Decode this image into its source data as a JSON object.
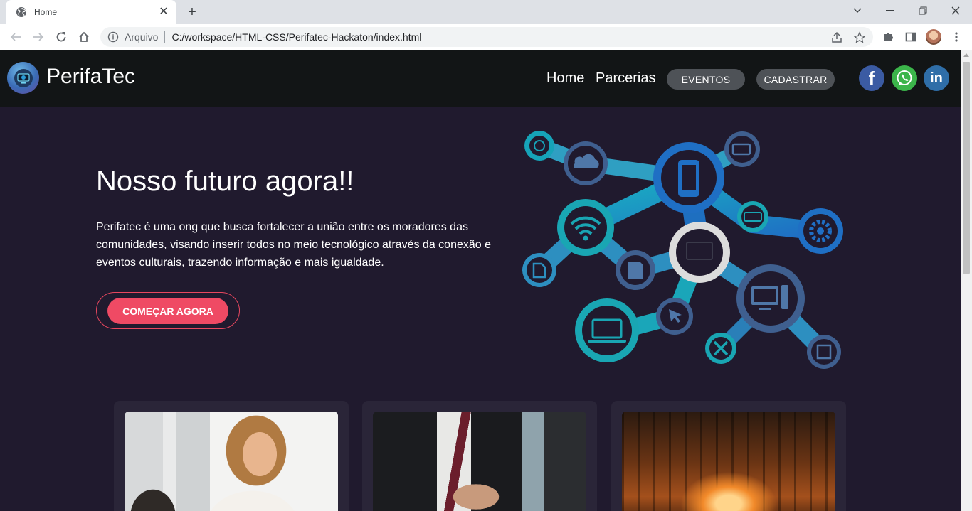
{
  "browser": {
    "tab_title": "Home",
    "new_tab_label": "+",
    "omnibox_label": "Arquivo",
    "url": "C:/workspace/HTML-CSS/Perifatec-Hackaton/index.html"
  },
  "nav": {
    "brand": "PerifaTec",
    "links": [
      "Home",
      "Parcerias"
    ],
    "eventos_label": "EVENTOS",
    "cadastrar_label": "CADASTRAR"
  },
  "hero": {
    "title": "Nosso futuro agora!!",
    "text": "Perifatec é uma ong que busca fortalecer a união entre os moradores das comunidades, visando inserir todos no meio tecnológico através da conexão e eventos culturais, trazendo informação e mais igualdade.",
    "cta_label": "COMEÇAR AGORA"
  },
  "social": {
    "facebook_glyph": "f",
    "linkedin_glyph": "in",
    "facebook_color": "#3b5ba3",
    "whatsapp_color": "#3bb54a",
    "linkedin_color": "#2f6ea8"
  },
  "colors": {
    "page_bg": "#201a2e",
    "navbar_bg": "#121516",
    "accent": "#ef4a64",
    "nav_button": "#4e5257"
  }
}
